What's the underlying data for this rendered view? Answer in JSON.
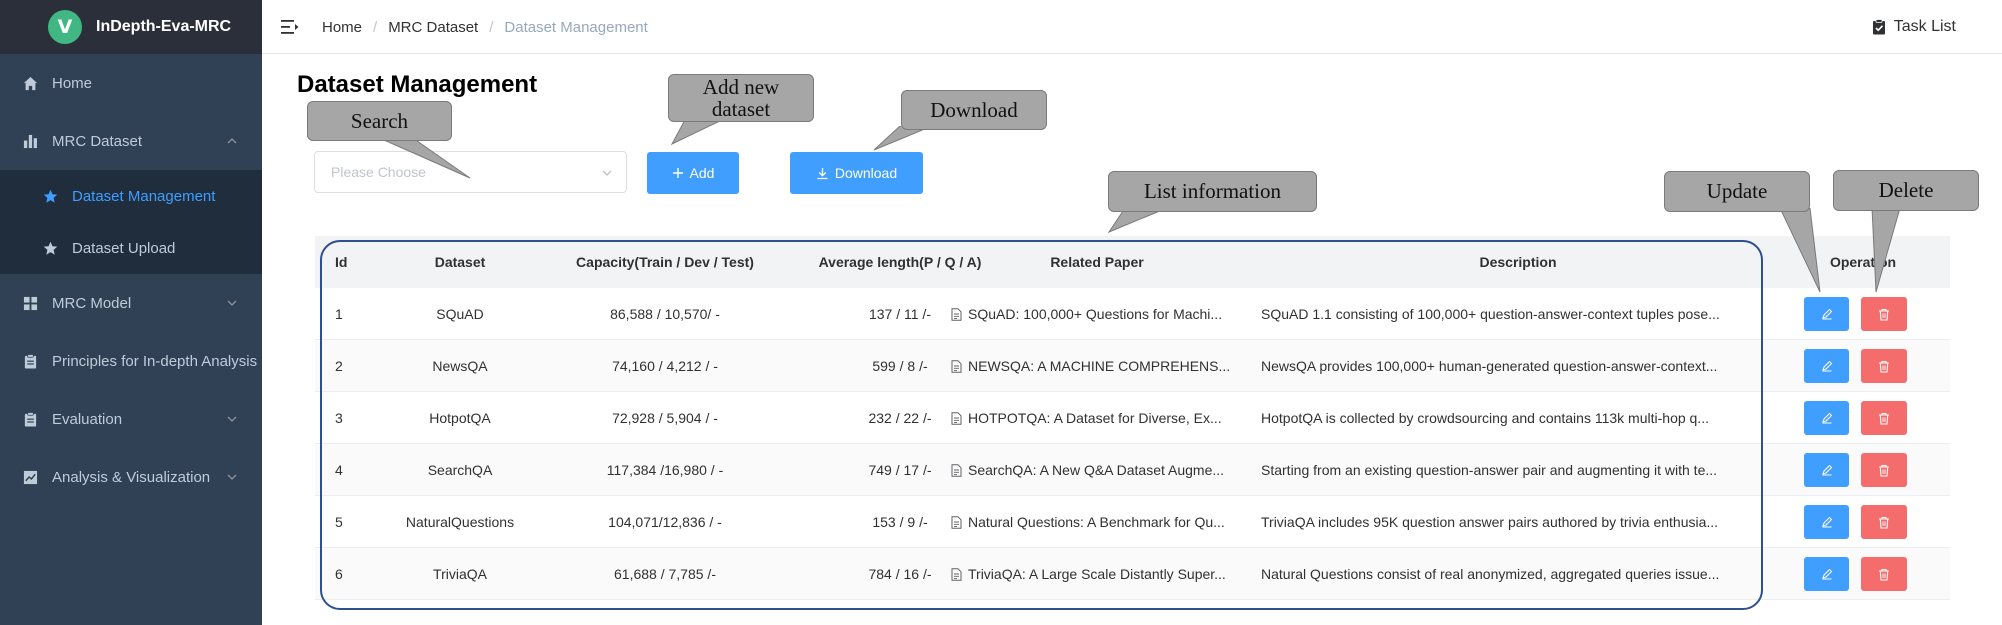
{
  "app": {
    "title": "InDepth-Eva-MRC",
    "logo_letter": "V",
    "accent": "#409eff",
    "sidebar_bg": "#304156"
  },
  "sidebar": {
    "items": [
      {
        "label": "Home",
        "icon": "home-icon"
      },
      {
        "label": "MRC Dataset",
        "icon": "bar-chart-icon",
        "expanded": true,
        "children": [
          {
            "label": "Dataset Management",
            "icon": "star-icon",
            "active": true
          },
          {
            "label": "Dataset Upload",
            "icon": "star-icon"
          }
        ]
      },
      {
        "label": "MRC Model",
        "icon": "grid-icon"
      },
      {
        "label": "Principles for In-depth Analysis",
        "icon": "clipboard-icon"
      },
      {
        "label": "Evaluation",
        "icon": "clipboard-icon"
      },
      {
        "label": "Analysis & Visualization",
        "icon": "trend-chart-icon"
      }
    ]
  },
  "header": {
    "breadcrumb": [
      "Home",
      "MRC Dataset",
      "Dataset Management"
    ],
    "task_list": "Task List"
  },
  "main": {
    "title": "Dataset Management",
    "search_placeholder": "Please Choose",
    "add_label": "Add",
    "download_label": "Download"
  },
  "table": {
    "columns": [
      "Id",
      "Dataset",
      "Capacity(Train / Dev / Test)",
      "Average length(P / Q / A)",
      "Related Paper",
      "Description",
      "Operation"
    ],
    "rows": [
      {
        "id": "1",
        "dataset": "SQuAD",
        "capacity": "86,588 / 10,570/ -",
        "avg": "137 / 11 /-",
        "paper": "SQuAD: 100,000+ Questions for Machi...",
        "desc": "SQuAD 1.1 consisting of 100,000+ question-answer-context tuples pose..."
      },
      {
        "id": "2",
        "dataset": "NewsQA",
        "capacity": "74,160 / 4,212 / -",
        "avg": "599 / 8 /-",
        "paper": "NEWSQA: A MACHINE COMPREHENS...",
        "desc": "NewsQA provides 100,000+ human-generated question-answer-context..."
      },
      {
        "id": "3",
        "dataset": "HotpotQA",
        "capacity": "72,928 / 5,904 / -",
        "avg": "232 / 22 /-",
        "paper": "HOTPOTQA: A Dataset for Diverse, Ex...",
        "desc": "HotpotQA is collected by crowdsourcing and contains 113k multi-hop q..."
      },
      {
        "id": "4",
        "dataset": "SearchQA",
        "capacity": "117,384 /16,980 / -",
        "avg": "749 / 17 /-",
        "paper": "SearchQA: A New Q&A Dataset Augme...",
        "desc": "Starting from an existing question-answer pair and augmenting it with te..."
      },
      {
        "id": "5",
        "dataset": "NaturalQuestions",
        "capacity": "104,071/12,836 / -",
        "avg": "153 / 9 /-",
        "paper": "Natural Questions: A Benchmark for Qu...",
        "desc": "TriviaQA includes 95K question answer pairs authored by trivia enthusia..."
      },
      {
        "id": "6",
        "dataset": "TriviaQA",
        "capacity": "61,688 / 7,785 /-",
        "avg": "784 / 16 /-",
        "paper": "TriviaQA: A Large Scale Distantly Super...",
        "desc": "Natural Questions consist of real anonymized, aggregated queries issue..."
      }
    ]
  },
  "callouts": {
    "search": "Search",
    "add": "Add new\ndataset",
    "download": "Download",
    "list": "List information",
    "update": "Update",
    "delete": "Delete"
  }
}
